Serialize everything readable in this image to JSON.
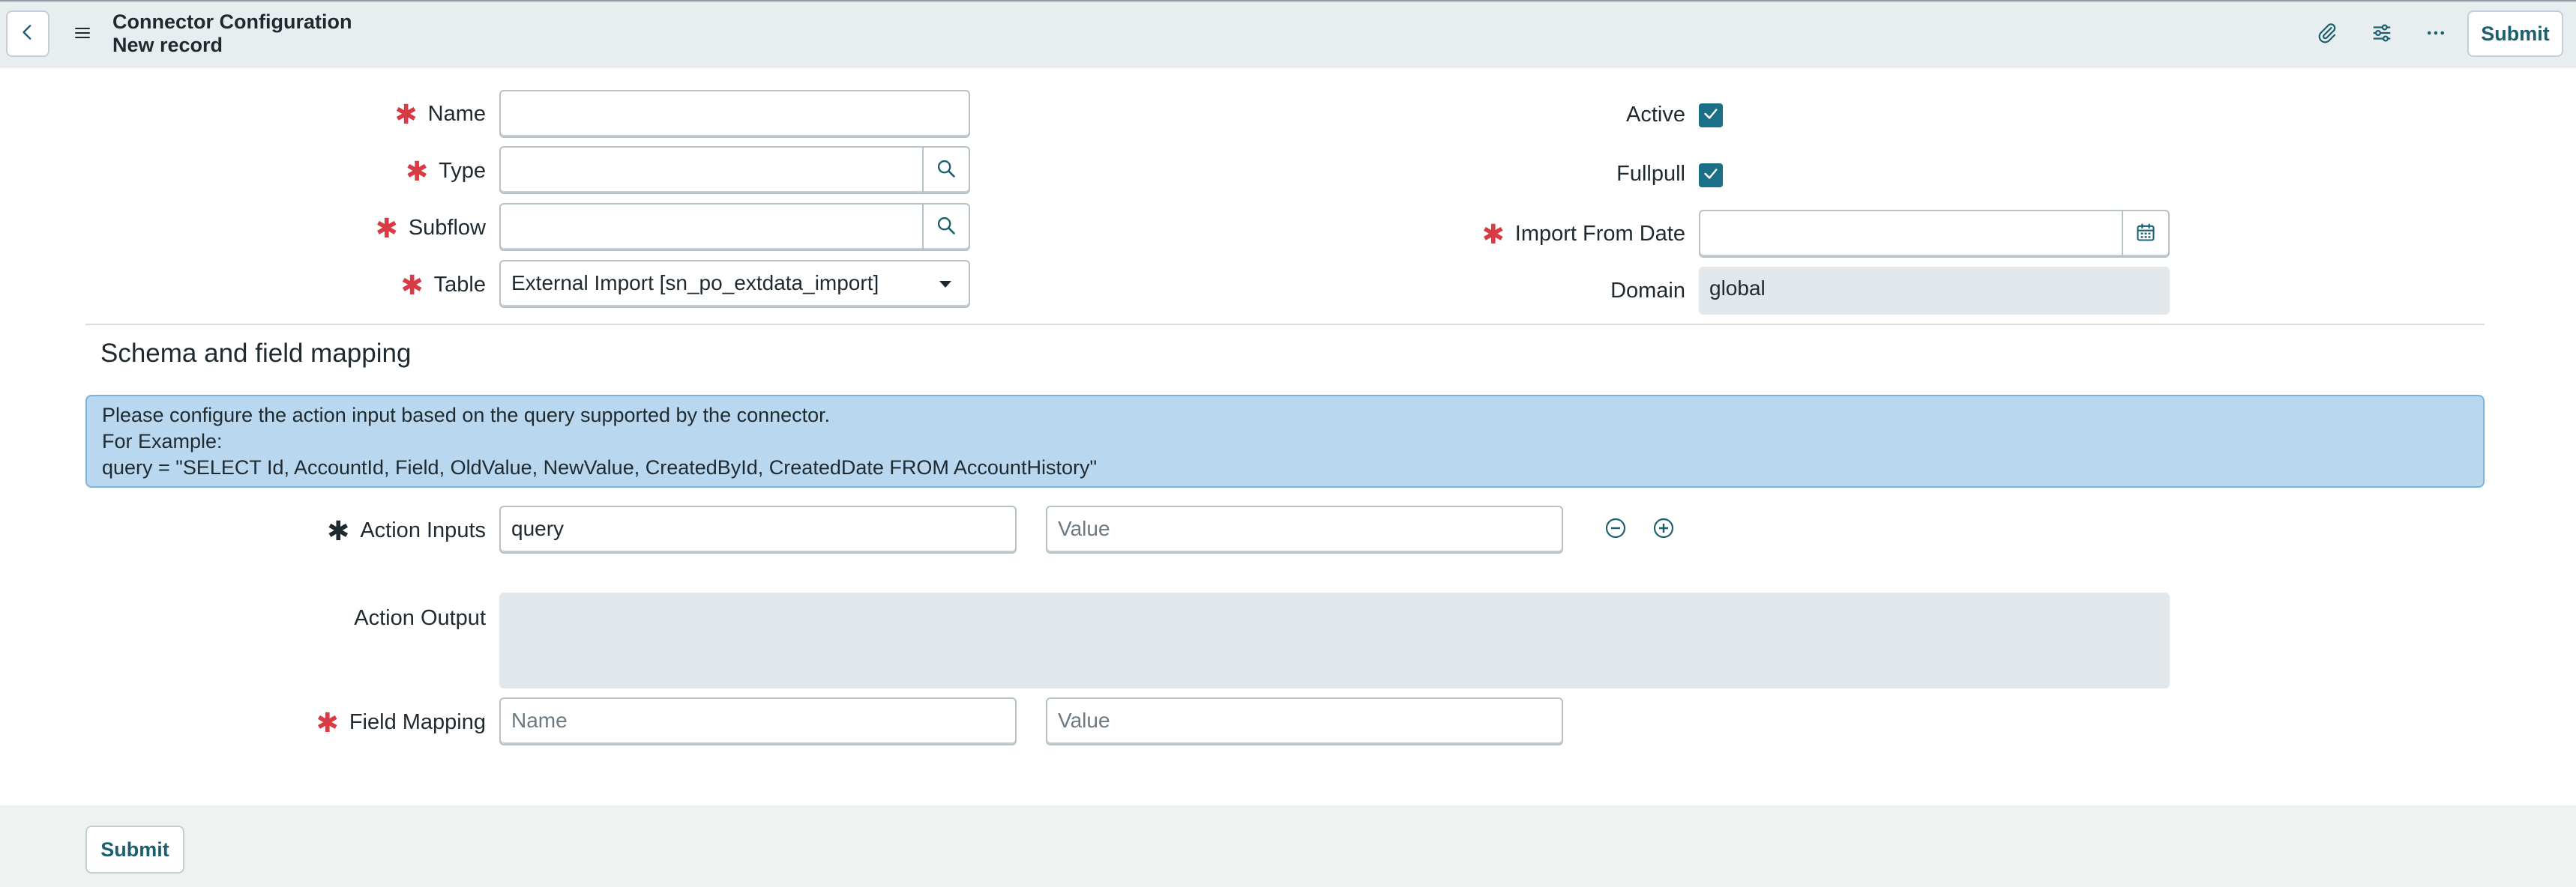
{
  "header": {
    "title": "Connector Configuration",
    "subtitle": "New record",
    "submit_label": "Submit",
    "icons": [
      "back-icon",
      "menu-icon",
      "attachment-icon",
      "settings-sliders-icon",
      "more-icon"
    ]
  },
  "form": {
    "name": {
      "label": "Name",
      "value": ""
    },
    "type": {
      "label": "Type",
      "value": ""
    },
    "subflow": {
      "label": "Subflow",
      "value": ""
    },
    "table": {
      "label": "Table",
      "value": "External Import [sn_po_extdata_import]"
    },
    "active": {
      "label": "Active",
      "checked": true
    },
    "fullpull": {
      "label": "Fullpull",
      "checked": true
    },
    "import_from_date": {
      "label": "Import From Date",
      "value": ""
    },
    "domain": {
      "label": "Domain",
      "value": "global"
    }
  },
  "section": {
    "title": "Schema and field mapping",
    "info_lines": [
      "Please configure the action input based on the query supported by the connector.",
      "For Example:",
      "query = \"SELECT Id, AccountId, Field, OldValue, NewValue, CreatedById, CreatedDate FROM AccountHistory\""
    ],
    "action_inputs": {
      "label": "Action Inputs",
      "key_value": "query",
      "value_placeholder": "Value"
    },
    "action_output": {
      "label": "Action Output",
      "value": ""
    },
    "field_mapping": {
      "label": "Field Mapping",
      "name_placeholder": "Name",
      "value_placeholder": "Value"
    }
  },
  "footer": {
    "submit_label": "Submit"
  },
  "colors": {
    "accent": "#1b6f86",
    "required": "#d93b45",
    "info_bg": "#b9d8ef",
    "header_bg": "#e8edf0"
  }
}
